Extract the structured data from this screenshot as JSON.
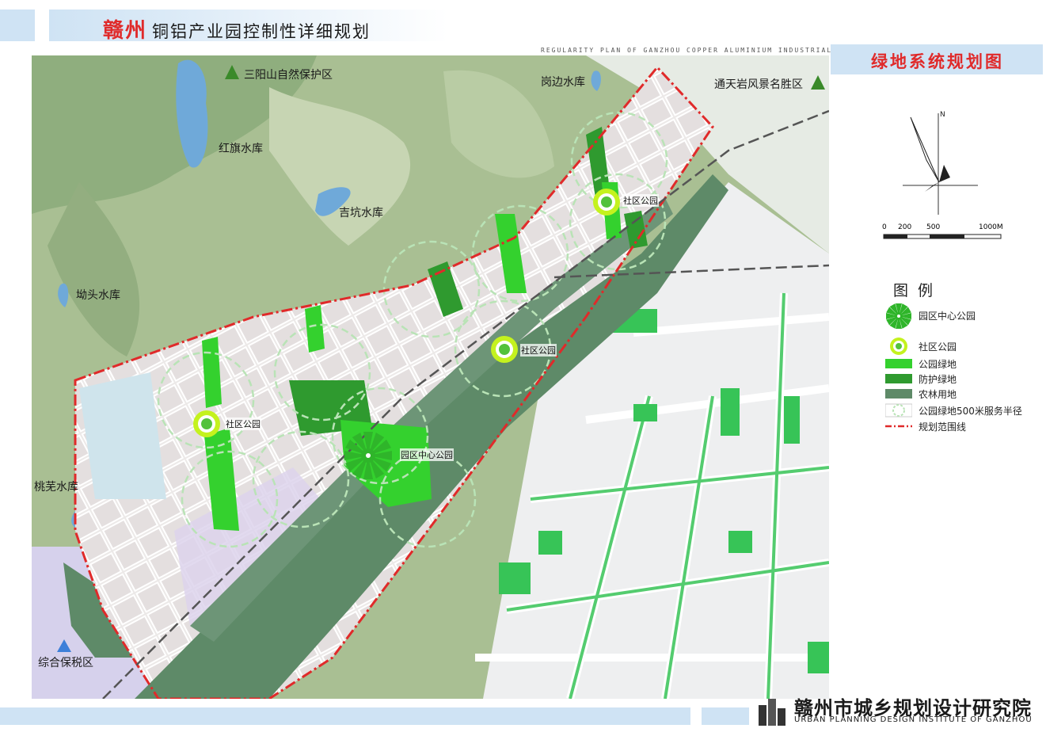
{
  "header": {
    "city": "赣州",
    "title": "铜铝产业园控制性详细规划",
    "subtitle_en": "REGULARITY PLAN OF GANZHOU COPPER ALUMINIUM INDUSTRIAL ZONE",
    "plan_title": "绿地系统规划图"
  },
  "map": {
    "labels": {
      "sanyang": "三阳山自然保护区",
      "hongqi": "红旗水库",
      "jikeng": "吉坑水库",
      "gangbian": "岗边水库",
      "tongtianyan": "通天岩风景名胜区",
      "aotou": "坳头水库",
      "taowu": "桃芜水库",
      "bonded": "综合保税区"
    },
    "parks": {
      "community_1": "社区公园",
      "community_2": "社区公园",
      "community_3": "社区公园",
      "central": "园区中心公园"
    }
  },
  "compass": {
    "north": "N"
  },
  "scale": {
    "ticks": [
      "0",
      "200",
      "500",
      "1000M"
    ]
  },
  "legend": {
    "title": "图例",
    "items": [
      {
        "label": "园区中心公园"
      },
      {
        "label": "社区公园"
      },
      {
        "label": "公园绿地"
      },
      {
        "label": "防护绿地"
      },
      {
        "label": "农林用地"
      },
      {
        "label": "公园绿地500米服务半径"
      },
      {
        "label": "规划范围线"
      }
    ]
  },
  "colors": {
    "park_green": "#34d12e",
    "protective_green": "#2f9a2f",
    "agri_green": "#5e8a68",
    "boundary_red": "#e02a2a",
    "terrain": "#9bb586",
    "reservoir": "#6fa9d9"
  },
  "footer": {
    "institute": "赣州市城乡规划设计研究院",
    "institute_en": "URBAN PLANNING DESIGN INSTITUTE OF GANZHOU"
  }
}
